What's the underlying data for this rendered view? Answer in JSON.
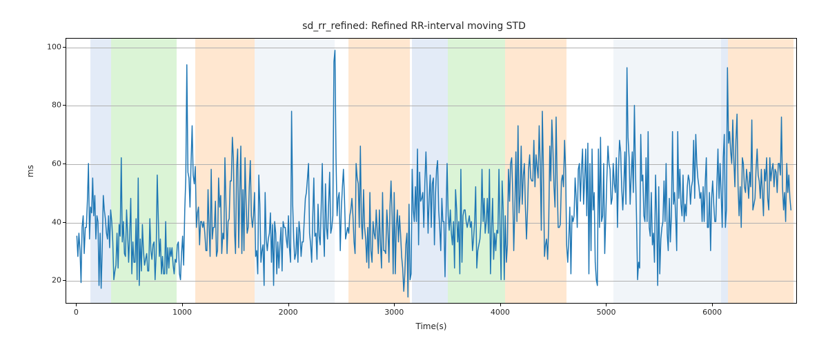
{
  "chart_data": {
    "type": "line",
    "title": "sd_rr_refined: Refined RR-interval moving STD",
    "xlabel": "Time(s)",
    "ylabel": "ms",
    "xlim": [
      -100,
      6800
    ],
    "ylim": [
      12,
      103
    ],
    "xticks": [
      0,
      1000,
      2000,
      3000,
      4000,
      5000,
      6000
    ],
    "yticks": [
      20,
      40,
      60,
      80,
      100
    ],
    "grid": true,
    "bands": [
      {
        "start": 130,
        "end": 320,
        "kind": "blue"
      },
      {
        "start": 320,
        "end": 940,
        "kind": "green"
      },
      {
        "start": 1120,
        "end": 1680,
        "kind": "orange"
      },
      {
        "start": 1680,
        "end": 1940,
        "kind": "lightblue"
      },
      {
        "start": 1940,
        "end": 2060,
        "kind": "lightblue"
      },
      {
        "start": 2060,
        "end": 2430,
        "kind": "lightblue"
      },
      {
        "start": 2560,
        "end": 3140,
        "kind": "orange"
      },
      {
        "start": 3160,
        "end": 3500,
        "kind": "blue"
      },
      {
        "start": 3500,
        "end": 4040,
        "kind": "green"
      },
      {
        "start": 4040,
        "end": 4620,
        "kind": "orange"
      },
      {
        "start": 5060,
        "end": 6080,
        "kind": "lightblue"
      },
      {
        "start": 6080,
        "end": 6140,
        "kind": "blue"
      },
      {
        "start": 6140,
        "end": 6760,
        "kind": "orange"
      }
    ],
    "x_sample_step": 10,
    "values": [
      35,
      28,
      36,
      30,
      19,
      38,
      42,
      29,
      38,
      38,
      47,
      60,
      34,
      45,
      43,
      55,
      42,
      49,
      34,
      42,
      40,
      18,
      36,
      17,
      30,
      49,
      44,
      41,
      36,
      34,
      42,
      31,
      44,
      40,
      33,
      20,
      23,
      25,
      36,
      24,
      39,
      35,
      62,
      33,
      40,
      29,
      28,
      44,
      36,
      26,
      36,
      48,
      22,
      33,
      26,
      26,
      41,
      20,
      55,
      18,
      34,
      23,
      39,
      30,
      25,
      27,
      29,
      23,
      23,
      41,
      30,
      27,
      32,
      33,
      20,
      29,
      56,
      41,
      28,
      34,
      22,
      28,
      22,
      22,
      40,
      22,
      31,
      24,
      31,
      28,
      31,
      25,
      22,
      27,
      26,
      32,
      33,
      22,
      20,
      29,
      35,
      25,
      44,
      55,
      94,
      57,
      55,
      45,
      61,
      73,
      56,
      53,
      59,
      38,
      43,
      45,
      32,
      40,
      40,
      38,
      40,
      36,
      30,
      30,
      51,
      38,
      28,
      58,
      34,
      38,
      38,
      47,
      28,
      30,
      55,
      45,
      49,
      29,
      36,
      34,
      62,
      45,
      29,
      40,
      41,
      54,
      54,
      69,
      62,
      37,
      29,
      58,
      65,
      31,
      49,
      66,
      29,
      51,
      30,
      62,
      46,
      36,
      38,
      52,
      61,
      42,
      38,
      42,
      50,
      28,
      30,
      22,
      56,
      46,
      26,
      30,
      32,
      18,
      50,
      34,
      30,
      34,
      36,
      43,
      26,
      39,
      18,
      40,
      36,
      22,
      33,
      24,
      32,
      38,
      23,
      40,
      38,
      38,
      34,
      31,
      42,
      31,
      26,
      78,
      46,
      34,
      27,
      29,
      38,
      26,
      40,
      36,
      28,
      33,
      33,
      41,
      48,
      50,
      55,
      60,
      36,
      32,
      26,
      41,
      55,
      35,
      36,
      27,
      46,
      35,
      32,
      45,
      60,
      38,
      28,
      53,
      38,
      34,
      46,
      57,
      36,
      38,
      42,
      95,
      99,
      62,
      42,
      48,
      50,
      30,
      44,
      52,
      58,
      48,
      34,
      36,
      38,
      36,
      42,
      44,
      48,
      42,
      33,
      29,
      60,
      55,
      53,
      38,
      66,
      40,
      34,
      51,
      38,
      34,
      26,
      38,
      24,
      50,
      30,
      26,
      40,
      36,
      34,
      44,
      36,
      29,
      44,
      32,
      24,
      50,
      30,
      30,
      29,
      44,
      38,
      26,
      45,
      54,
      42,
      22,
      50,
      22,
      38,
      44,
      33,
      42,
      36,
      28,
      24,
      16,
      22,
      32,
      36,
      14,
      46,
      20,
      22,
      58,
      44,
      40,
      52,
      40,
      65,
      32,
      57,
      47,
      48,
      50,
      38,
      54,
      64,
      52,
      36,
      48,
      56,
      38,
      53,
      55,
      32,
      49,
      58,
      61,
      44,
      38,
      30,
      48,
      40,
      40,
      21,
      42,
      60,
      42,
      37,
      44,
      36,
      32,
      40,
      24,
      51,
      44,
      33,
      40,
      22,
      58,
      26,
      42,
      44,
      44,
      40,
      38,
      40,
      42,
      38,
      40,
      30,
      34,
      40,
      52,
      24,
      30,
      32,
      34,
      40,
      58,
      40,
      48,
      36,
      40,
      48,
      36,
      58,
      22,
      38,
      48,
      27,
      36,
      30,
      37,
      36,
      58,
      38,
      20,
      54,
      44,
      20,
      42,
      26,
      32,
      58,
      47,
      60,
      62,
      50,
      30,
      45,
      64,
      40,
      73,
      43,
      49,
      66,
      46,
      56,
      60,
      45,
      34,
      44,
      58,
      63,
      55,
      54,
      54,
      68,
      52,
      63,
      59,
      55,
      73,
      60,
      37,
      78,
      59,
      28,
      32,
      34,
      27,
      38,
      66,
      54,
      75,
      65,
      52,
      45,
      76,
      54,
      38,
      38,
      39,
      54,
      56,
      52,
      68,
      58,
      32,
      26,
      34,
      45,
      22,
      42,
      40,
      42,
      55,
      48,
      38,
      58,
      60,
      47,
      58,
      65,
      46,
      55,
      65,
      42,
      67,
      22,
      60,
      30,
      65,
      44,
      50,
      26,
      20,
      18,
      65,
      38,
      69,
      40,
      42,
      60,
      29,
      42,
      55,
      66,
      60,
      58,
      46,
      48,
      60,
      53,
      50,
      62,
      38,
      58,
      68,
      64,
      52,
      44,
      52,
      64,
      46,
      93,
      69,
      62,
      46,
      56,
      64,
      50,
      80,
      58,
      42,
      20,
      26,
      24,
      70,
      54,
      56,
      42,
      40,
      62,
      40,
      71,
      38,
      35,
      50,
      32,
      36,
      26,
      56,
      42,
      18,
      52,
      22,
      34,
      38,
      40,
      54,
      40,
      60,
      36,
      30,
      48,
      33,
      42,
      71,
      46,
      50,
      42,
      30,
      71,
      48,
      58,
      46,
      42,
      56,
      40,
      46,
      42,
      52,
      56,
      54,
      46,
      52,
      54,
      68,
      48,
      70,
      60,
      55,
      52,
      48,
      50,
      40,
      52,
      40,
      54,
      62,
      38,
      38,
      50,
      30,
      48,
      54,
      46,
      40,
      40,
      53,
      65,
      48,
      60,
      50,
      38,
      62,
      70,
      38,
      44,
      93,
      67,
      71,
      64,
      60,
      75,
      61,
      52,
      68,
      77,
      52,
      42,
      52,
      38,
      62,
      60,
      52,
      50,
      58,
      54,
      48,
      57,
      52,
      75,
      44,
      46,
      48,
      58,
      65,
      56,
      54,
      48,
      58,
      50,
      42,
      58,
      54,
      62,
      48,
      44,
      62,
      54,
      58,
      60,
      52,
      58,
      57,
      50,
      60,
      60,
      56,
      76,
      52,
      44,
      50,
      40,
      60,
      50,
      56,
      48,
      44
    ]
  }
}
